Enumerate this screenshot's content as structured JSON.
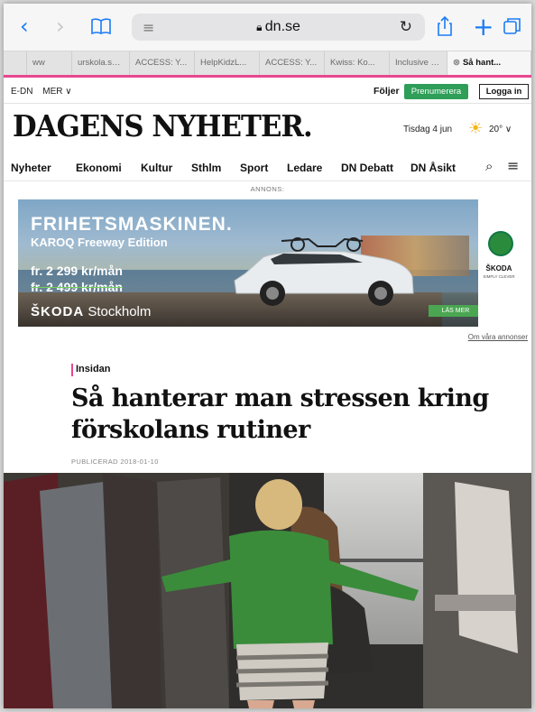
{
  "browser": {
    "url": "dn.se",
    "tabs": [
      "ww",
      "urskola.se...",
      "ACCESS: Y...",
      "HelpKidzL...",
      "ACCESS: Y...",
      "Kwiss: Ko...",
      "Inclusive T...",
      "Så hant..."
    ],
    "active_tab_index": 7
  },
  "site": {
    "top_links": [
      "E-DN",
      "MER ∨"
    ],
    "follow_label": "Följer",
    "subscribe_label": "Prenumerera",
    "login_label": "Logga in",
    "masthead": "DAGENS NYHETER.",
    "date": "Tisdag 4 jun",
    "temperature": "20° ∨",
    "nav": [
      "Nyheter",
      "Ekonomi",
      "Kultur",
      "Sthlm",
      "Sport",
      "Ledare",
      "DN Debatt",
      "DN Åsikt"
    ]
  },
  "ad": {
    "label": "ANNONS:",
    "headline": "FRIHETSMASKINEN.",
    "subheadline": "KAROQ Freeway Edition",
    "price": "fr. 2 299 kr/mån",
    "old_price": "fr. 2 499 kr/mån",
    "dealer_brand": "ŠKODA",
    "dealer_city": "Stockholm",
    "cta": "LÄS MER",
    "logo_word": "ŠKODA",
    "logo_sub": "SIMPLY CLEVER",
    "link": "Om våra annonser"
  },
  "article": {
    "section": "Insidan",
    "headline": "Så hanterar man stressen kring förskolans rutiner",
    "published": "PUBLICERAD 2018-01-10"
  },
  "colors": {
    "accent_pink": "#e8468f",
    "subscribe_green": "#2e9e58",
    "ios_blue": "#1a7cf5"
  }
}
